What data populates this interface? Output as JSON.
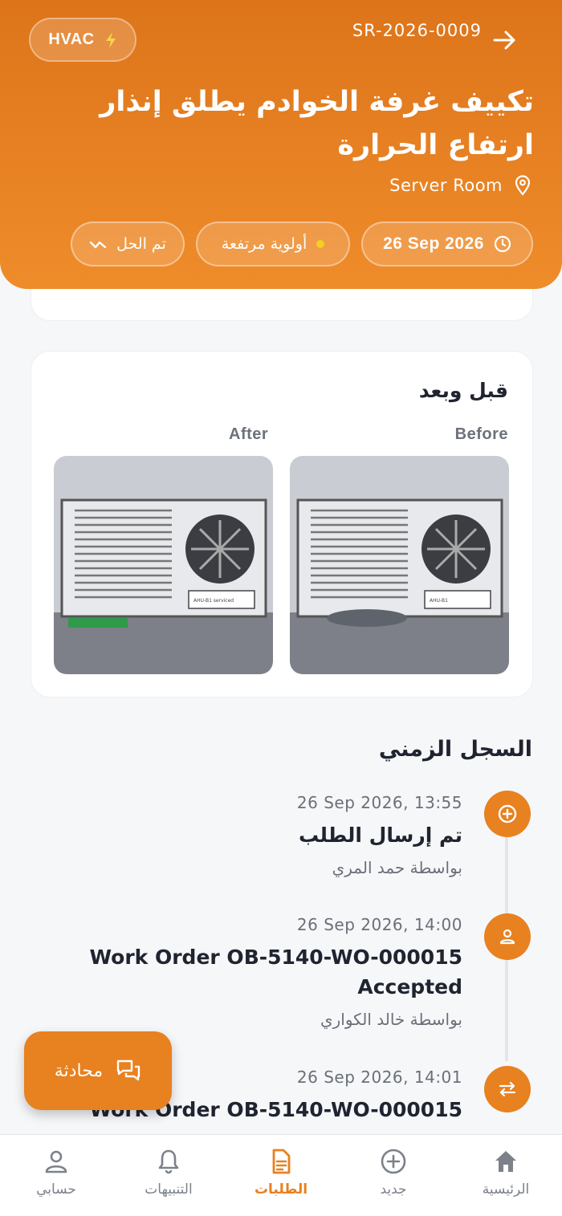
{
  "header": {
    "category": "HVAC",
    "reference": "SR-2026-0009",
    "title": "تكييف غرفة الخوادم يطلق إنذار ارتفاع الحرارة",
    "location": "Server Room",
    "date": "26 Sep 2026",
    "priority": "أولوية مرتفعة",
    "status": "تم الحل",
    "colors": {
      "accent": "#e8811f",
      "priority_dot": "#f3cf22"
    }
  },
  "before_after": {
    "title": "قبل وبعد",
    "before_label": "Before",
    "after_label": "After",
    "before_tag": "AHU-B1",
    "after_tag": "AHU-B1 serviced"
  },
  "timeline": {
    "heading": "السجل الزمني",
    "events": [
      {
        "time": "26 Sep 2026, 13:55",
        "title": "تم إرسال الطلب",
        "by": "بواسطة حمد المري",
        "icon": "plus-circle-icon"
      },
      {
        "time": "26 Sep 2026, 14:00",
        "title": "Work Order OB-5140-WO-000015 Accepted",
        "by": "بواسطة خالد الكواري",
        "icon": "user-icon"
      },
      {
        "time": "26 Sep 2026, 14:01",
        "title": "Work Order OB-5140-WO-000015",
        "by": "",
        "icon": "swap-icon"
      }
    ]
  },
  "chat_button": {
    "label": "محادثة",
    "icon": "chat-icon"
  },
  "bottom_nav": [
    {
      "label": "الرئيسية",
      "icon": "home-icon"
    },
    {
      "label": "جديد",
      "icon": "plus-circle-icon"
    },
    {
      "label": "الطلبات",
      "icon": "document-icon",
      "active": true
    },
    {
      "label": "التنبيهات",
      "icon": "bell-icon"
    },
    {
      "label": "حسابي",
      "icon": "user-icon"
    }
  ]
}
